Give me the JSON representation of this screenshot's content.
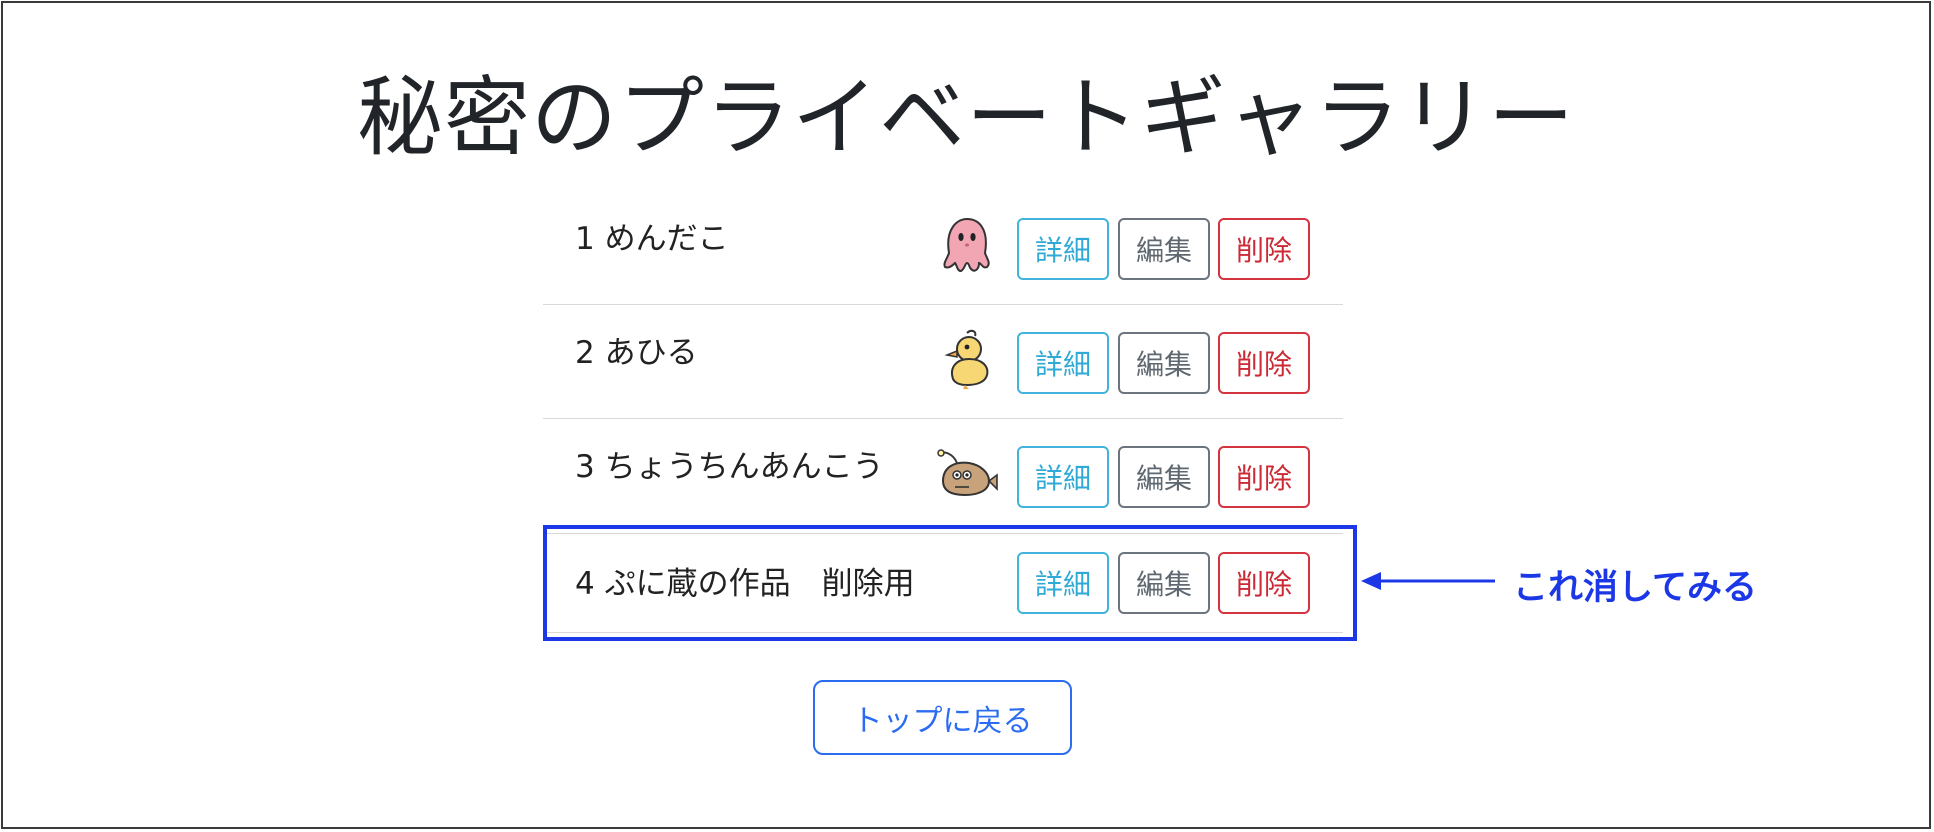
{
  "page": {
    "title": "秘密のプライベートギャラリー"
  },
  "items": [
    {
      "label": "1 めんだこ",
      "icon": "pink-octopus-icon"
    },
    {
      "label": "2 あひる",
      "icon": "yellow-duck-icon"
    },
    {
      "label": "3 ちょうちんあんこう",
      "icon": "anglerfish-icon"
    },
    {
      "label": "4 ぷに蔵の作品　削除用",
      "icon": ""
    }
  ],
  "buttons": {
    "detail": "詳細",
    "edit": "編集",
    "delete": "削除"
  },
  "annotation": {
    "text": "これ消してみる",
    "color": "#1b37e6"
  },
  "back_button": {
    "label": "トップに戻る"
  },
  "colors": {
    "detail": "#2fa9d6",
    "edit": "#5f6870",
    "delete": "#cc2a35",
    "primary": "#2b6cf0"
  }
}
